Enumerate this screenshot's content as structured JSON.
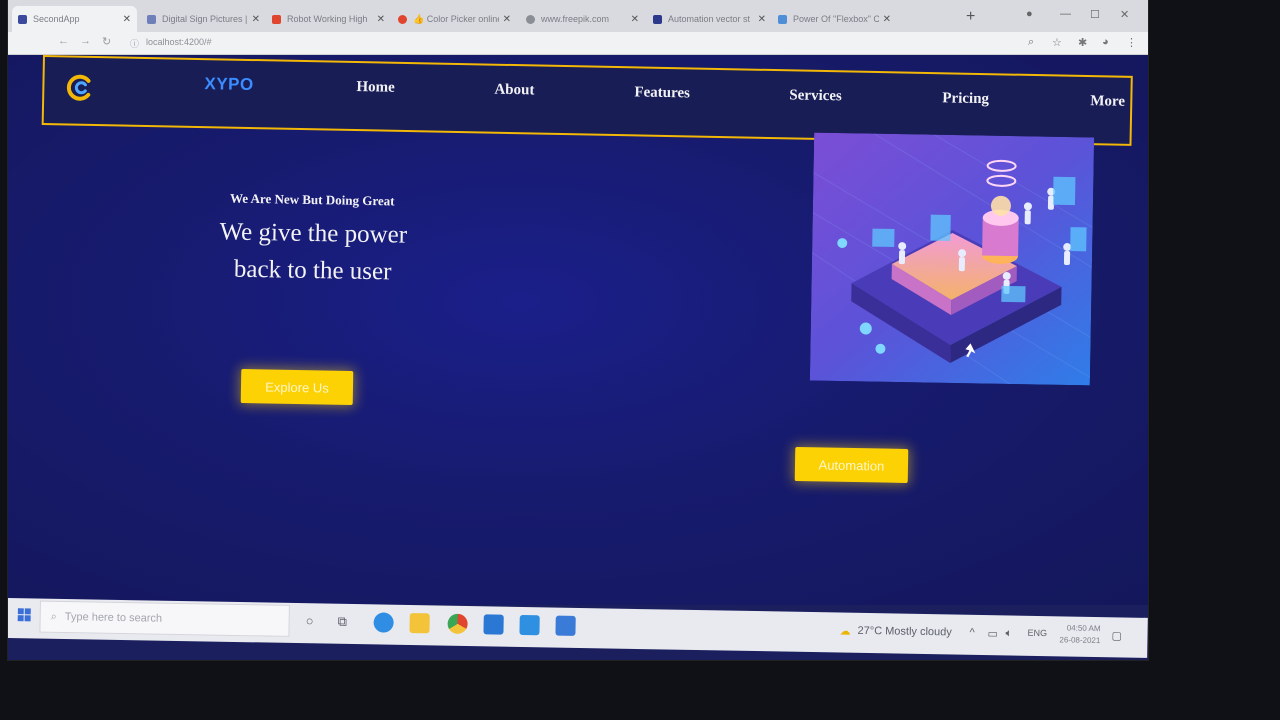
{
  "browser": {
    "tabs": [
      {
        "title": "SecondApp",
        "fav": "#3c4a9e"
      },
      {
        "title": "Digital Sign Pictures |",
        "fav": "#6f7fb9"
      },
      {
        "title": "Robot Working High",
        "fav": "#e0452e"
      },
      {
        "title": "👍 Color Picker online",
        "fav": "#e0452e"
      },
      {
        "title": "www.freepik.com",
        "fav": "#8b8e95"
      },
      {
        "title": "Automation vector st",
        "fav": "#2d3a8c"
      },
      {
        "title": "Power Of \"Flexbox\" C",
        "fav": "#4f8fd8"
      }
    ],
    "new_tab": "+",
    "url": "localhost:4200/#"
  },
  "site": {
    "brand": "XYPO",
    "nav": [
      "Home",
      "About",
      "Features",
      "Services",
      "Pricing",
      "More"
    ],
    "hero_sub": "We Are New But Doing Great",
    "hero_title_line1": "We give the power",
    "hero_title_line2": "back to the user",
    "explore_button": "Explore Us",
    "automation_button": "Automation"
  },
  "taskbar": {
    "search_placeholder": "Type here to search",
    "weather": "27°C  Mostly cloudy",
    "language": "ENG",
    "time": "04:50 AM",
    "date": "26-08-2021"
  },
  "colors": {
    "accent_yellow": "#fcd205",
    "brand_blue": "#3b8cff",
    "page_bg": "#171b6e",
    "nav_border": "#f2b707"
  }
}
